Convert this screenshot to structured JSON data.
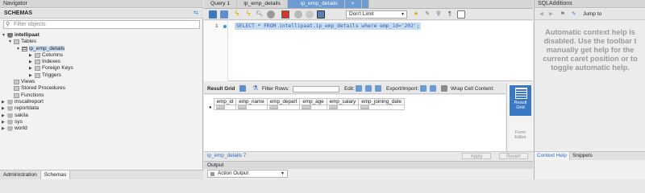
{
  "navigator": {
    "title": "Navigator",
    "schemas_label": "SCHEMAS",
    "filter_placeholder": "Filter objects",
    "tree": [
      {
        "label": "intellipaat",
        "bold": true
      },
      {
        "label": "Tables"
      },
      {
        "label": "ip_emp_details"
      },
      {
        "label": "Columns"
      },
      {
        "label": "Indexes"
      },
      {
        "label": "Foreign Keys"
      },
      {
        "label": "Triggers"
      },
      {
        "label": "Views"
      },
      {
        "label": "Stored Procedures"
      },
      {
        "label": "Functions"
      },
      {
        "label": "mscallreport"
      },
      {
        "label": "reportdata"
      },
      {
        "label": "sakila"
      },
      {
        "label": "sys"
      },
      {
        "label": "world"
      }
    ],
    "tabs": [
      "Administration",
      "Schemas"
    ]
  },
  "editor": {
    "tabs": [
      "Query 1",
      "ip_emp_details",
      "ip_emp_details"
    ],
    "limit": "Don't Limit",
    "line_number": "1",
    "sql": "SELECT * FROM intellipaat.ip_emp_details where emp_id='202';"
  },
  "results": {
    "result_grid_label": "Result Grid",
    "filter_rows_label": "Filter Rows:",
    "edit_label": "Edit:",
    "export_label": "Export/Import:",
    "wrap_label": "Wrap Cell Content:",
    "columns": [
      "emp_id",
      "emp_name",
      "emp_depart",
      "emp_age",
      "emp_salary",
      "emp_joining_date"
    ],
    "null_label": "NULL",
    "side_result_grid": "Result Grid",
    "side_form_editor": "Form Editor",
    "result_tab": "ip_emp_details 7",
    "apply": "Apply",
    "revert": "Revert"
  },
  "output": {
    "title": "Output",
    "selector": "Action Output"
  },
  "sql_additions": {
    "title": "SQLAdditions",
    "jump_to": "Jump to",
    "help_lines": [
      "Automatic context help is",
      "disabled. Use the toolbar t",
      "manually get help for the",
      "current caret position or to",
      "toggle automatic help."
    ],
    "tabs": [
      "Context Help",
      "Snippets"
    ]
  },
  "colors": {
    "accent": "#3b78c4",
    "sql_text": "#2e5db3",
    "selection": "#c8dcf0"
  }
}
